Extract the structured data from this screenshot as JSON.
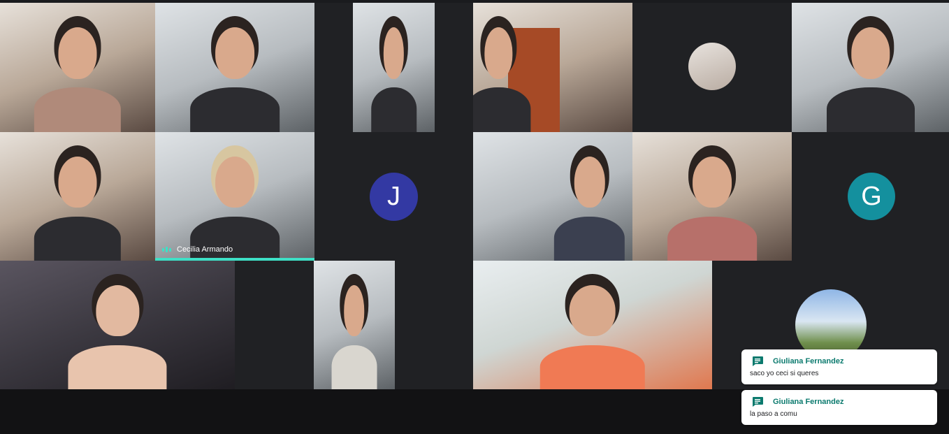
{
  "participants": {
    "speaker_name": "Cecilia Armando",
    "initial_j": "J",
    "initial_g": "G"
  },
  "colors": {
    "avatar_j": "#3339a3",
    "avatar_g": "#14909e",
    "speaking_accent": "#3ee0c6",
    "chat_sender": "#0b7a6e"
  },
  "chat_toasts": [
    {
      "sender": "Giuliana Fernandez",
      "message": "saco yo ceci si queres"
    },
    {
      "sender": "Giuliana Fernandez",
      "message": "la paso a comu"
    }
  ]
}
